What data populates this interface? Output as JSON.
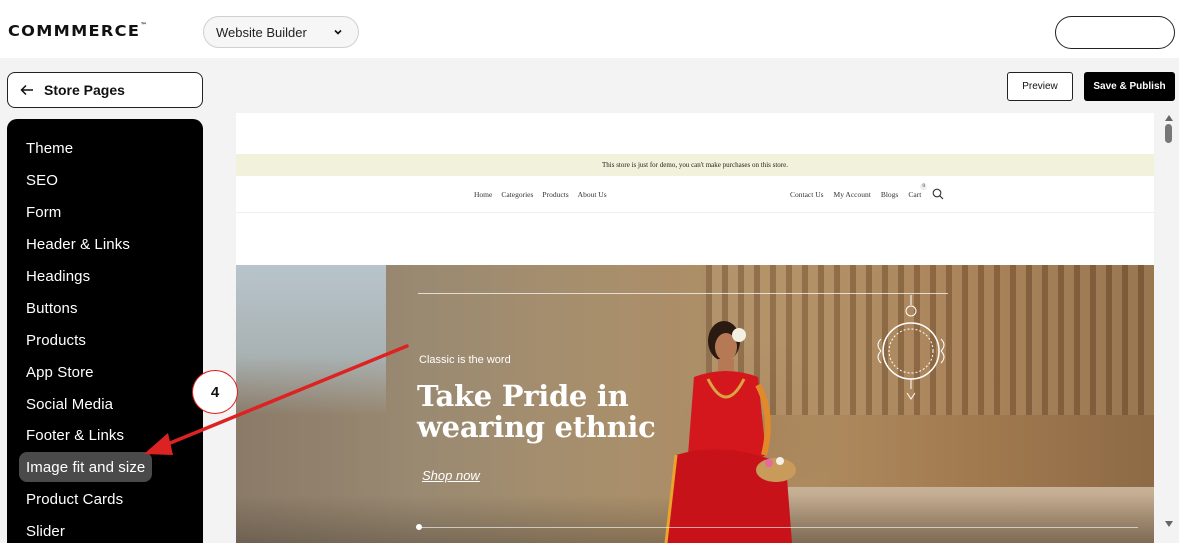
{
  "brand": {
    "logo_text": "COMMMERCE",
    "trademark": "™"
  },
  "header": {
    "builder_select": {
      "value": "Website Builder",
      "icon": "chevron-down-icon"
    },
    "profile_pill": {
      "label": ""
    }
  },
  "toolbar": {
    "back_label": "Store Pages",
    "back_icon": "arrow-left-icon",
    "preview_label": "Preview",
    "publish_label": "Save & Publish"
  },
  "sidebar": {
    "items": [
      {
        "label": "Theme"
      },
      {
        "label": "SEO"
      },
      {
        "label": "Form"
      },
      {
        "label": "Header & Links"
      },
      {
        "label": "Headings"
      },
      {
        "label": "Buttons"
      },
      {
        "label": "Products"
      },
      {
        "label": "App Store"
      },
      {
        "label": "Social Media"
      },
      {
        "label": "Footer & Links"
      },
      {
        "label": "Image fit and size"
      },
      {
        "label": "Product Cards"
      },
      {
        "label": "Slider"
      }
    ],
    "active_index": 10
  },
  "preview": {
    "demo_banner": "This store is just for demo, you can't make purchases on this store.",
    "nav_left": [
      "Home",
      "Categories",
      "Products",
      "About Us"
    ],
    "nav_right": [
      "Contact Us",
      "My Account",
      "Blogs",
      "Cart"
    ],
    "cart_count": "0",
    "hero": {
      "tagline": "Classic is the word",
      "title_line1": "Take Pride in",
      "title_line2": "wearing ethnic",
      "cta": "Shop now"
    }
  },
  "annotation": {
    "step_number": "4",
    "color": "#dd2222"
  },
  "colors": {
    "accent": "#000000",
    "banner_bg": "#f2f1dc",
    "saree_red": "#d4171c"
  }
}
